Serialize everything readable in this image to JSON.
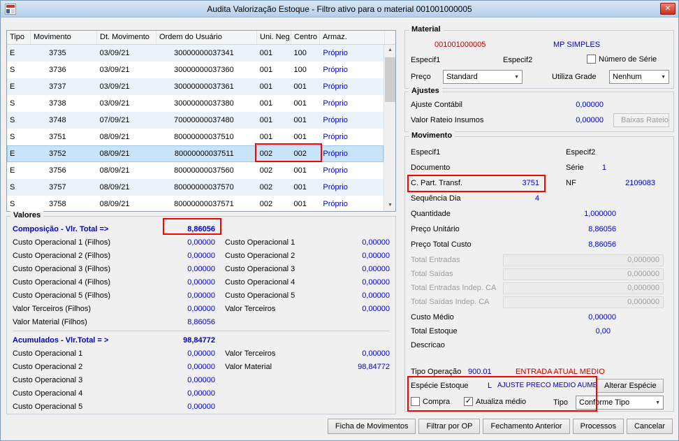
{
  "window": {
    "title": "Audita Valorização Estoque - Filtro ativo para o material 001001000005",
    "close_glyph": "✕"
  },
  "colors": {
    "value_blue": "#0000c8",
    "alert_red": "#c00000",
    "annotation_red": "#ff0000",
    "selection_blue": "#c9e3f8",
    "title_bar_blue": "#bcd4ec"
  },
  "grid": {
    "columns": [
      "Tipo",
      "Movimento",
      "Dt. Movimento",
      "Ordem do Usuário",
      "Uni. Neg.",
      "Centro",
      "Armaz."
    ],
    "rows": [
      [
        "E",
        "3735",
        "03/09/21",
        "30000000037341",
        "001",
        "100",
        "Próprio"
      ],
      [
        "S",
        "3736",
        "03/09/21",
        "30000000037360",
        "001",
        "100",
        "Próprio"
      ],
      [
        "E",
        "3737",
        "03/09/21",
        "30000000037361",
        "001",
        "001",
        "Próprio"
      ],
      [
        "S",
        "3738",
        "03/09/21",
        "30000000037380",
        "001",
        "001",
        "Próprio"
      ],
      [
        "S",
        "3748",
        "07/09/21",
        "70000000037480",
        "001",
        "001",
        "Próprio"
      ],
      [
        "S",
        "3751",
        "08/09/21",
        "80000000037510",
        "001",
        "001",
        "Próprio"
      ],
      [
        "E",
        "3752",
        "08/09/21",
        "80000000037511",
        "002",
        "002",
        "Próprio"
      ],
      [
        "E",
        "3756",
        "08/09/21",
        "80000000037560",
        "002",
        "001",
        "Próprio"
      ],
      [
        "S",
        "3757",
        "08/09/21",
        "80000000037570",
        "002",
        "001",
        "Próprio"
      ],
      [
        "S",
        "3758",
        "08/09/21",
        "80000000037571",
        "002",
        "001",
        "Próprio"
      ]
    ],
    "selected_row": 6
  },
  "valores": {
    "title": "Valores",
    "composicao": {
      "label": "Composição - Vlr. Total =>",
      "value": "8,86056"
    },
    "comp_left": [
      {
        "label": "Custo Operacional 1 (Filhos)",
        "value": "0,00000"
      },
      {
        "label": "Custo Operacional 2 (Filhos)",
        "value": "0,00000"
      },
      {
        "label": "Custo Operacional 3 (Filhos)",
        "value": "0,00000"
      },
      {
        "label": "Custo Operacional 4 (Filhos)",
        "value": "0,00000"
      },
      {
        "label": "Custo Operacional 5 (Filhos)",
        "value": "0,00000"
      },
      {
        "label": "Valor Terceiros (Filhos)",
        "value": "0,00000"
      },
      {
        "label": "Valor Material (Filhos)",
        "value": "8,86056"
      }
    ],
    "comp_right": [
      {
        "label": "Custo Operacional 1",
        "value": "0,00000"
      },
      {
        "label": "Custo Operacional 2",
        "value": "0,00000"
      },
      {
        "label": "Custo Operacional 3",
        "value": "0,00000"
      },
      {
        "label": "Custo Operacional 4",
        "value": "0,00000"
      },
      {
        "label": "Custo Operacional 5",
        "value": "0,00000"
      },
      {
        "label": "Valor Terceiros",
        "value": "0,00000"
      }
    ],
    "acumulados": {
      "label": "Acumulados - Vlr.Total = >",
      "value": "98,84772"
    },
    "acum_left": [
      {
        "label": "Custo Operacional 1",
        "value": "0,00000"
      },
      {
        "label": "Custo Operacional 2",
        "value": "0,00000"
      },
      {
        "label": "Custo Operacional 3",
        "value": "0,00000"
      },
      {
        "label": "Custo Operacional 4",
        "value": "0,00000"
      },
      {
        "label": "Custo Operacional 5",
        "value": "0,00000"
      }
    ],
    "acum_right": [
      {
        "label": "Valor Terceiros",
        "value": "0,00000"
      },
      {
        "label": "Valor Material",
        "value": "98,84772"
      }
    ]
  },
  "material": {
    "title": "Material",
    "code": "001001000005",
    "type": "MP SIMPLES",
    "especif1": "Especif1",
    "especif2": "Especif2",
    "numero_serie_label": "Número de Série",
    "preco_label": "Preço",
    "preco_value": "Standard",
    "grade_label": "Utiliza Grade",
    "grade_value": "Nenhum"
  },
  "ajustes": {
    "title": "Ajustes",
    "rows": [
      {
        "label": "Ajuste Contábil",
        "value": "0,00000"
      },
      {
        "label": "Valor Rateio Insumos",
        "value": "0,00000"
      }
    ],
    "baixas_button": "Baixas Rateio"
  },
  "movimento": {
    "title": "Movimento",
    "especif1": "Especif1",
    "especif2": "Especif2",
    "documento_label": "Documento",
    "serie_label": "Série",
    "serie_value": "1",
    "cpart_label": "C. Part. Transf.",
    "cpart_value": "3751",
    "nf_label": "NF",
    "nf_value": "2109083",
    "seq_label": "Sequência Dia",
    "seq_value": "4",
    "quantidade_label": "Quantidade",
    "quantidade_value": "1,000000",
    "preco_unit_label": "Preço Unitário",
    "preco_unit_value": "8,86056",
    "preco_total_label": "Preço Total Custo",
    "preco_total_value": "8,86056",
    "disabled_fields": [
      {
        "label": "Total Entradas",
        "value": "0,000000"
      },
      {
        "label": "Total Saídas",
        "value": "0,000000"
      },
      {
        "label": "Total Entradas Indep. CA",
        "value": "0,000000"
      },
      {
        "label": "Total Saídas Indep. CA",
        "value": "0,000000"
      }
    ],
    "custo_medio_label": "Custo Médio",
    "custo_medio_value": "0,00000",
    "total_estoque_label": "Total Estoque",
    "total_estoque_value": "0,00",
    "descricao_label": "Descricao",
    "tipo_operacao_label": "Tipo Operação",
    "tipo_operacao_code": "900.01",
    "tipo_operacao_desc": "ENTRADA ATUAL MEDIO",
    "especie_label": "Espécie Estoque",
    "especie_code": "L",
    "especie_desc": "AJUSTE PRECO MEDIO AUMENTA",
    "alterar_button": "Alterar Espécie",
    "compra_label": "Compra",
    "atualiza_label": "Atualiza médio",
    "tipo_label": "Tipo",
    "tipo_value": "Conforme Tipo"
  },
  "footer": {
    "buttons": [
      "Ficha de Movimentos",
      "Filtrar por OP",
      "Fechamento Anterior",
      "Processos",
      "Cancelar"
    ]
  }
}
